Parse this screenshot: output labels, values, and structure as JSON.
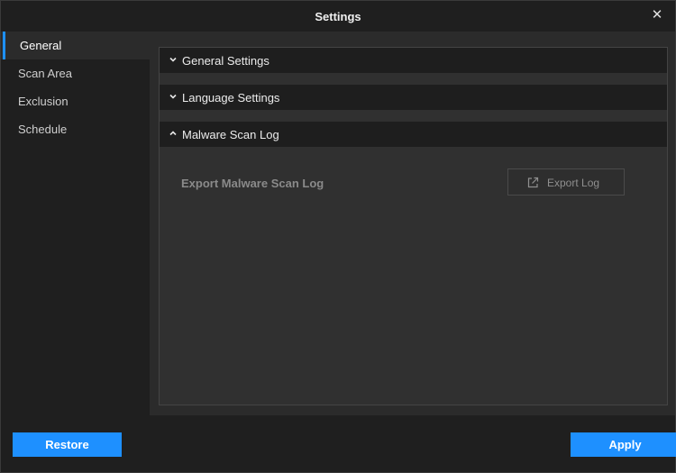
{
  "window": {
    "title": "Settings"
  },
  "sidebar": {
    "items": [
      {
        "label": "General",
        "active": true
      },
      {
        "label": "Scan Area",
        "active": false
      },
      {
        "label": "Exclusion",
        "active": false
      },
      {
        "label": "Schedule",
        "active": false
      }
    ]
  },
  "sections": [
    {
      "label": "General Settings",
      "expanded": false
    },
    {
      "label": "Language Settings",
      "expanded": false
    },
    {
      "label": "Malware Scan Log",
      "expanded": true
    }
  ],
  "malware_log": {
    "export_label": "Export Malware Scan Log",
    "export_button": "Export Log"
  },
  "footer": {
    "restore_label": "Restore",
    "apply_label": "Apply"
  },
  "colors": {
    "accent": "#1e90ff",
    "background": "#1f1f1f",
    "panel": "#303030"
  },
  "icons": {
    "close": "close-icon",
    "collapsed": "chevron-down-icon",
    "expanded": "chevron-up-icon",
    "export": "external-link-icon"
  }
}
